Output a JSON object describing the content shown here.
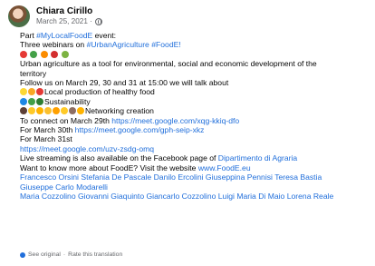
{
  "post": {
    "author": "Chiara Cirillo",
    "date": "March 25, 2021 ·",
    "lines": {
      "l1_prefix": "Part ",
      "l1_tag": "#MyLocalFoodE",
      "l1_suffix": " event:",
      "l2_prefix": "Three webinars on ",
      "l2_tags": "#UrbanAgriculture #FoodE!",
      "l4": "Urban agriculture as a tool for environmental, social and economic development of the",
      "l5": "territory",
      "l6": "Follow us on March 29, 30 and 31 at 15:00 we will talk about",
      "l7": "Local production of healthy food",
      "l8": "Sustainability",
      "l9": "Networking creation",
      "l10_prefix": "To connect on March 29th ",
      "l10_link": "https://meet.google.com/xqg-kkiq-dfo",
      "l11_prefix": "For March 30th ",
      "l11_link": "https://meet.google.com/gph-seip-xkz",
      "l12": "For March 31st",
      "l13_link": "https://meet.google.com/uzv-zsdg-omq",
      "l14_prefix": "Live streaming is also available on the Facebook page of ",
      "l14_link": "Dipartimento di Agraria",
      "l15_prefix": "Want to know more about FoodE? Visit the website ",
      "l15_link": "www.FoodE.eu",
      "mentions_1": "Francesco Orsini Stefania De Pascale Danilo Ercolini  Giuseppina Pennisi  Teresa Bastia",
      "mentions_2": "Giuseppe Carlo Modarelli",
      "mentions_3": "Maria Cozzolino Giovanni Giaquinto Giancarlo Cozzolino Luigi Maria Di Maio Lorena Reale"
    },
    "footer": {
      "see_original": "See original",
      "separator": "·",
      "rate": "Rate this translation"
    }
  },
  "icons": {
    "avatar": "profile-photo",
    "globe": "globe-icon",
    "see_original": "translate-icon"
  },
  "colors": {
    "link": "#216fdb",
    "meta": "#65676b",
    "text": "#050505"
  }
}
